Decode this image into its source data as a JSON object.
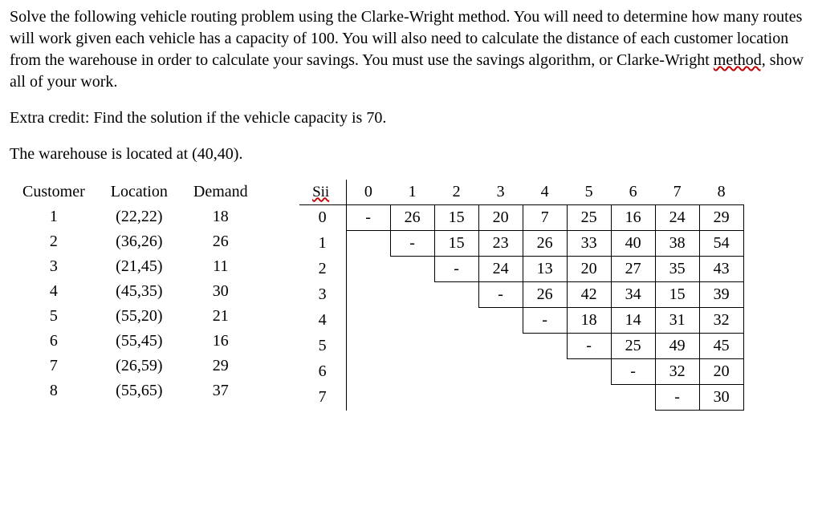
{
  "paragraphs": {
    "p1a": "Solve the following vehicle routing problem using the Clarke-Wright method. You will need to determine how many routes will work given each vehicle has a capacity of 100.  You will also need to calculate the distance of each customer location from the warehouse in order to calculate your savings.  You must use the savings algorithm, or Clarke-Wright ",
    "p1_wavy": "method,",
    "p1b": " show all of your work.",
    "p2": "Extra credit:  Find the solution if the vehicle capacity is 70.",
    "p3": "The warehouse is located at (40,40)."
  },
  "left": {
    "headers": [
      "Customer",
      "Location",
      "Demand"
    ],
    "rows": [
      {
        "c": "1",
        "loc": "(22,22)",
        "d": "18"
      },
      {
        "c": "2",
        "loc": "(36,26)",
        "d": "26"
      },
      {
        "c": "3",
        "loc": "(21,45)",
        "d": "11"
      },
      {
        "c": "4",
        "loc": "(45,35)",
        "d": "30"
      },
      {
        "c": "5",
        "loc": "(55,20)",
        "d": "21"
      },
      {
        "c": "6",
        "loc": "(55,45)",
        "d": "16"
      },
      {
        "c": "7",
        "loc": "(26,59)",
        "d": "29"
      },
      {
        "c": "8",
        "loc": "(55,65)",
        "d": "37"
      }
    ]
  },
  "matrix": {
    "corner": "Sii",
    "cols": [
      "0",
      "1",
      "2",
      "3",
      "4",
      "5",
      "6",
      "7",
      "8"
    ],
    "rowlabels": [
      "0",
      "1",
      "2",
      "3",
      "4",
      "5",
      "6",
      "7"
    ],
    "cells": [
      [
        "-",
        "26",
        "15",
        "20",
        "7",
        "25",
        "16",
        "24",
        "29"
      ],
      [
        "",
        "-",
        "15",
        "23",
        "26",
        "33",
        "40",
        "38",
        "54"
      ],
      [
        "",
        "",
        "-",
        "24",
        "13",
        "20",
        "27",
        "35",
        "43"
      ],
      [
        "",
        "",
        "",
        "-",
        "26",
        "42",
        "34",
        "15",
        "39"
      ],
      [
        "",
        "",
        "",
        "",
        "-",
        "18",
        "14",
        "31",
        "32"
      ],
      [
        "",
        "",
        "",
        "",
        "",
        "-",
        "25",
        "49",
        "45"
      ],
      [
        "",
        "",
        "",
        "",
        "",
        "",
        "-",
        "32",
        "20"
      ],
      [
        "",
        "",
        "",
        "",
        "",
        "",
        "",
        "-",
        "30"
      ]
    ]
  }
}
